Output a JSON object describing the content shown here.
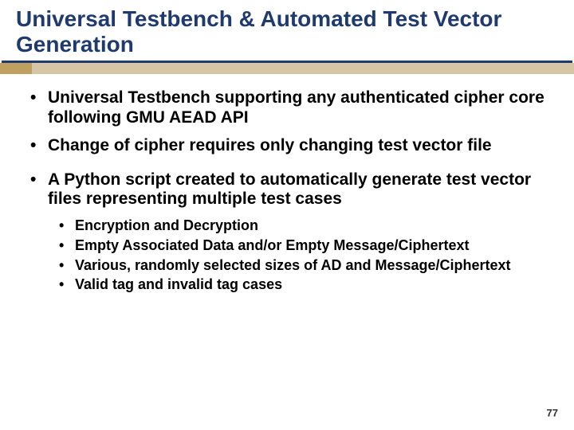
{
  "title": "Universal Testbench & Automated Test Vector Generation",
  "bullets": {
    "b1": "Universal Testbench supporting any authenticated cipher core following GMU AEAD API",
    "b2": "Change of cipher requires only changing test vector file",
    "b3": "A Python script created to automatically generate test vector files representing multiple test cases",
    "sub": {
      "s1": "Encryption and Decryption",
      "s2": "Empty Associated Data and/or Empty Message/Ciphertext",
      "s3": "Various, randomly selected sizes of AD and Message/Ciphertext",
      "s4": "Valid tag and invalid tag cases"
    }
  },
  "page_number": "77"
}
